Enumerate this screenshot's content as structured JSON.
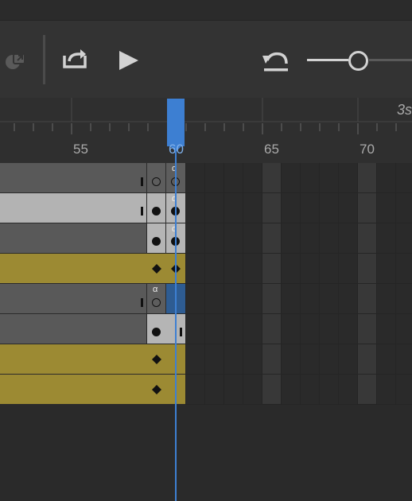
{
  "theme": {
    "playhead": "#3d7fd2",
    "tween_fill": "#9c8a33",
    "frame_dark": "#585858",
    "frame_light": "#b4b4b4"
  },
  "toolbar": {
    "icons": [
      "link-layers-icon",
      "loop-icon",
      "play-icon",
      "undo-icon",
      "zoom-slider"
    ]
  },
  "ruler": {
    "labels": [
      "55",
      "65",
      "70"
    ],
    "playhead_label": "60",
    "time_label": "3s"
  },
  "layers": [
    {
      "kind": "keyframe",
      "style": "dark",
      "marker": "hollow",
      "current": "hollow",
      "action": true
    },
    {
      "kind": "keyframe",
      "style": "light",
      "marker": "filled",
      "current": "filled",
      "action": true
    },
    {
      "kind": "keyframe",
      "style": "dark",
      "marker": "filled",
      "current": "filled",
      "action": true
    },
    {
      "kind": "tween",
      "marker": "diamond",
      "current": "diamond",
      "action": false
    },
    {
      "kind": "keyframe",
      "style": "dark",
      "marker": "hollow",
      "current": "none",
      "action": true
    },
    {
      "kind": "keyframe",
      "style": "dark",
      "marker": "filled",
      "current": "end",
      "action": false
    },
    {
      "kind": "tween",
      "marker": "diamond",
      "current": "none",
      "action": false
    },
    {
      "kind": "tween",
      "marker": "diamond",
      "current": "none",
      "action": false
    }
  ]
}
